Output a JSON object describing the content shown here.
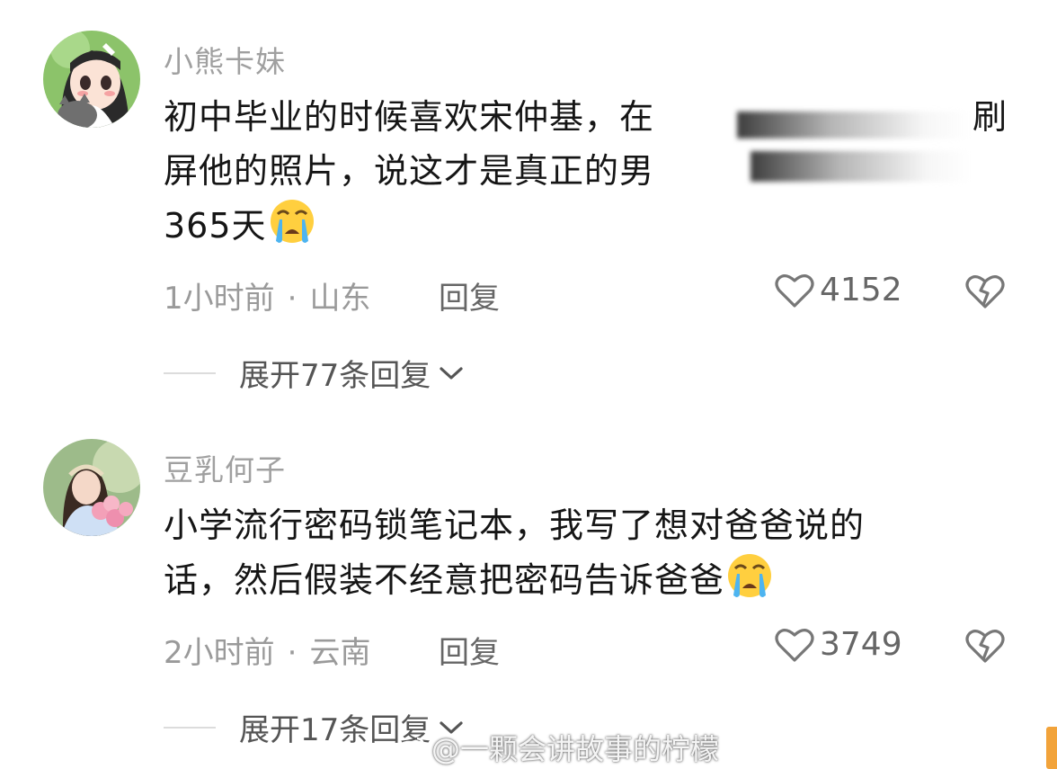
{
  "comments": [
    {
      "username": "小熊卡妹",
      "text_line1": "初中毕业的时候喜欢宋仲基，在",
      "text_line1_tail": "刷",
      "text_line2": "屏他的照片，说这才是真正的男",
      "text_line3": "365天",
      "time": "1小时前",
      "location": "山东",
      "reply_label": "回复",
      "likes": "4152",
      "expand_label": "展开77条回复"
    },
    {
      "username": "豆乳何子",
      "text_line1": "小学流行密码锁笔记本，我写了想对爸爸说的",
      "text_line2": "话，然后假装不经意把密码告诉爸爸",
      "time": "2小时前",
      "location": "云南",
      "reply_label": "回复",
      "likes": "3749",
      "expand_label": "展开17条回复"
    }
  ],
  "meta_separator": "·",
  "watermark": "@一颗会讲故事的柠檬",
  "icons": {
    "like": "heart-outline-icon",
    "dislike": "broken-heart-icon",
    "expand": "chevron-down-icon",
    "emoji": "crying-face-emoji"
  },
  "colors": {
    "username": "#a0a0a0",
    "meta": "#9a9a9a",
    "accent_tab": "#f2a33a"
  }
}
